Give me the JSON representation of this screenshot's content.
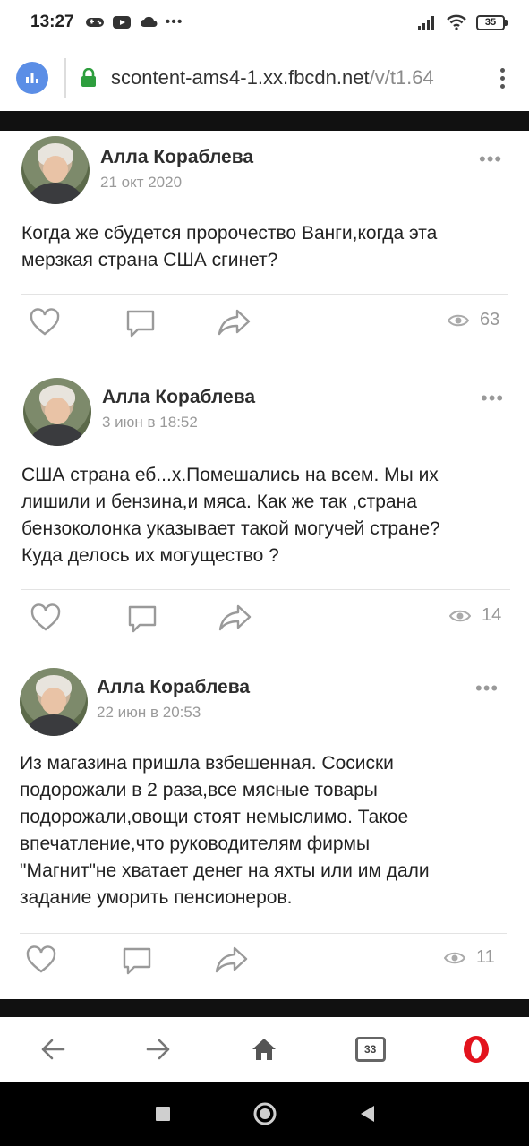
{
  "status_bar": {
    "time": "13:27",
    "battery": "35",
    "more_indicator": "•••"
  },
  "browser": {
    "url_host": "scontent-ams4-1.xx.fbcdn.net",
    "url_path": "/v/t1.64",
    "tabs_count": "33",
    "accent_color": "#5b8ee6",
    "lock_color": "#2e9e3e",
    "opera_color": "#e3131d"
  },
  "posts": [
    {
      "author": "Алла Кораблева",
      "date": "21 окт 2020",
      "text_lines": [
        "Когда же сбудется пророчество Ванги,когда эта",
        "мерзкая страна США сгинет?"
      ],
      "views": "63"
    },
    {
      "author": "Алла Кораблева",
      "date": "3 июн в 18:52",
      "text_lines": [
        "США страна еб...х.Помешались на всем. Мы их",
        "лишили и бензина,и мяса. Как же так ,страна",
        "бензоколонка указывает такой могучей стране?",
        "Куда делось их могущество ?"
      ],
      "views": "14"
    },
    {
      "author": "Алла Кораблева",
      "date": "22 июн в 20:53",
      "text_lines": [
        "Из магазина пришла взбешенная. Сосиски",
        "подорожали в 2 раза,все мясные товары",
        "подорожали,овощи стоят немыслимо. Такое",
        "впечатление,что руководителям фирмы",
        "\"Магнит\"не хватает денег на яхты или им дали",
        "задание уморить пенсионеров."
      ],
      "views": "11"
    }
  ],
  "more_label": "•••"
}
